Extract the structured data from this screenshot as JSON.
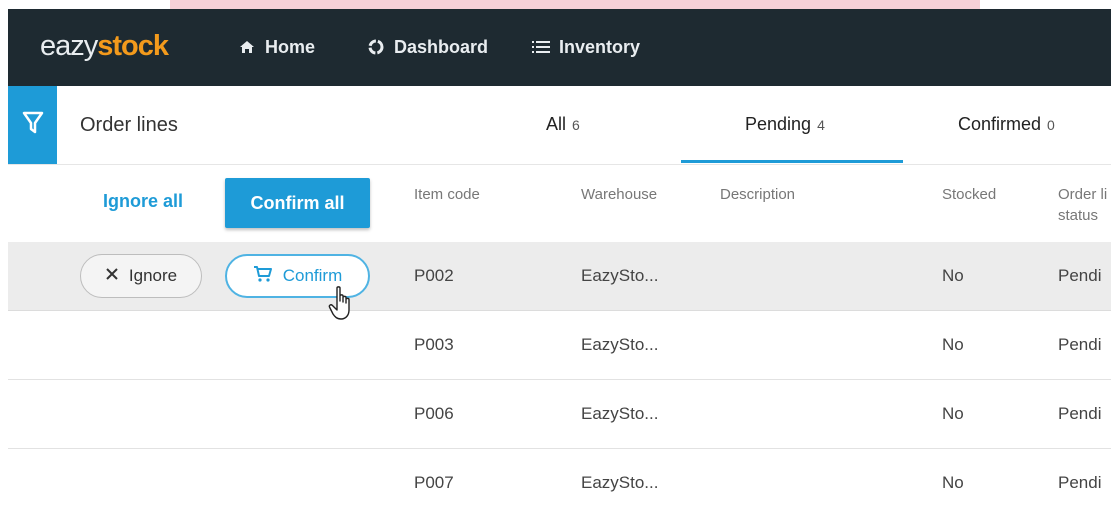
{
  "app": {
    "logo_light": "eazy",
    "logo_bold": "stock"
  },
  "nav": [
    {
      "label": "Home",
      "icon": "home-icon"
    },
    {
      "label": "Dashboard",
      "icon": "dashboard-icon"
    },
    {
      "label": "Inventory",
      "icon": "list-icon"
    }
  ],
  "header": {
    "title": "Order lines",
    "filter_icon": "filter-icon",
    "tabs": [
      {
        "label": "All",
        "count": "6"
      },
      {
        "label": "Pending",
        "count": "4",
        "active": true
      },
      {
        "label": "Confirmed",
        "count": "0"
      }
    ]
  },
  "actions": {
    "ignore_all": "Ignore all",
    "confirm_all": "Confirm all"
  },
  "table": {
    "columns": [
      "Item code",
      "Warehouse",
      "Description",
      "Stocked",
      "Order li",
      "status"
    ],
    "row_actions": {
      "ignore": "Ignore",
      "confirm": "Confirm"
    },
    "rows": [
      {
        "item_code": "P002",
        "warehouse": "EazySto...",
        "description": "",
        "stocked": "No",
        "status": "Pendi"
      },
      {
        "item_code": "P003",
        "warehouse": "EazySto...",
        "description": "",
        "stocked": "No",
        "status": "Pendi"
      },
      {
        "item_code": "P006",
        "warehouse": "EazySto...",
        "description": "",
        "stocked": "No",
        "status": "Pendi"
      },
      {
        "item_code": "P007",
        "warehouse": "EazySto...",
        "description": "",
        "stocked": "No",
        "status": "Pendi"
      }
    ]
  },
  "colors": {
    "navbar": "#1e2a31",
    "accent": "#1e9bd7",
    "logo_accent": "#f39a1c"
  }
}
